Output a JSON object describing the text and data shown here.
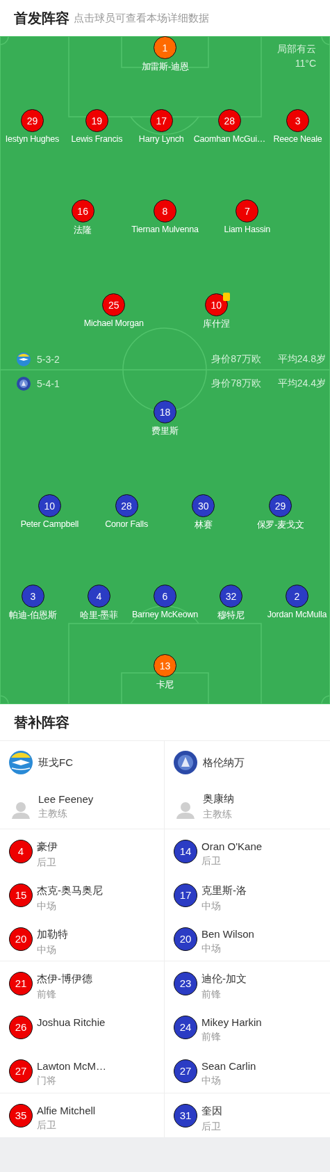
{
  "header": {
    "title": "首发阵容",
    "hint": "点击球员可查看本场详细数据"
  },
  "weather": {
    "condition": "局部有云",
    "temperature": "11°C"
  },
  "teams": [
    {
      "color": "#ee0000",
      "formation": "5-3-2",
      "value": "身价87万欧",
      "avg_age": "平均24.8岁",
      "lines": [
        [
          {
            "number": "1",
            "name": "加雷斯-迪恩",
            "kind": "goalkeeper",
            "yellow_card": false
          }
        ],
        [
          {
            "number": "29",
            "name": "Iestyn Hughes",
            "kind": "outfield",
            "yellow_card": false
          },
          {
            "number": "19",
            "name": "Lewis Francis",
            "kind": "outfield",
            "yellow_card": false
          },
          {
            "number": "17",
            "name": "Harry Lynch",
            "kind": "outfield",
            "yellow_card": false
          },
          {
            "number": "28",
            "name": "Caomhan McGui…",
            "kind": "outfield",
            "yellow_card": false
          },
          {
            "number": "3",
            "name": "Reece Neale",
            "kind": "outfield",
            "yellow_card": false
          }
        ],
        [
          {
            "number": "16",
            "name": "法隆",
            "kind": "outfield",
            "yellow_card": false
          },
          {
            "number": "8",
            "name": "Tiernan Mulvenna",
            "kind": "outfield",
            "yellow_card": false
          },
          {
            "number": "7",
            "name": "Liam Hassin",
            "kind": "outfield",
            "yellow_card": false
          }
        ],
        [
          {
            "number": "25",
            "name": "Michael Morgan",
            "kind": "outfield",
            "yellow_card": false
          },
          {
            "number": "10",
            "name": "库什涅",
            "kind": "outfield",
            "yellow_card": true
          }
        ]
      ]
    },
    {
      "color": "#2b3cc4",
      "formation": "5-4-1",
      "value": "身价78万欧",
      "avg_age": "平均24.4岁",
      "lines": [
        [
          {
            "number": "18",
            "name": "费里斯",
            "kind": "outfield",
            "yellow_card": false
          }
        ],
        [
          {
            "number": "10",
            "name": "Peter Campbell",
            "kind": "outfield",
            "yellow_card": false
          },
          {
            "number": "28",
            "name": "Conor Falls",
            "kind": "outfield",
            "yellow_card": false
          },
          {
            "number": "30",
            "name": "林赛",
            "kind": "outfield",
            "yellow_card": false
          },
          {
            "number": "29",
            "name": "保罗-麦戈文",
            "kind": "outfield",
            "yellow_card": false
          }
        ],
        [
          {
            "number": "3",
            "name": "帕迪-伯恩斯",
            "kind": "outfield",
            "yellow_card": false
          },
          {
            "number": "4",
            "name": "哈里-墨菲",
            "kind": "outfield",
            "yellow_card": false
          },
          {
            "number": "6",
            "name": "Barney McKeown",
            "kind": "outfield",
            "yellow_card": false
          },
          {
            "number": "32",
            "name": "穆特尼",
            "kind": "outfield",
            "yellow_card": false
          },
          {
            "number": "2",
            "name": "Jordan McMulla",
            "kind": "outfield",
            "yellow_card": false
          }
        ],
        [
          {
            "number": "13",
            "name": "卡尼",
            "kind": "goalkeeper",
            "yellow_card": false
          }
        ]
      ]
    }
  ],
  "substitutes": {
    "title": "替补阵容",
    "teams": [
      {
        "color": "#ee0000",
        "name": "班戈FC",
        "coach": {
          "name": "Lee Feeney",
          "role": "主教练"
        },
        "groups": [
          [
            {
              "number": "4",
              "name": "豪伊",
              "position": "后卫"
            },
            {
              "number": "15",
              "name": "杰克-奥马奥尼",
              "position": "中场"
            },
            {
              "number": "20",
              "name": "加勒特",
              "position": "中场"
            }
          ],
          [
            {
              "number": "21",
              "name": "杰伊-博伊德",
              "position": "前锋"
            },
            {
              "number": "26",
              "name": "Joshua Ritchie"
            },
            {
              "number": "27",
              "name": "Lawton McM…",
              "position": "门将"
            }
          ],
          [
            {
              "number": "35",
              "name": "Alfie Mitchell",
              "position": "后卫"
            }
          ]
        ]
      },
      {
        "color": "#2b3cc4",
        "name": "格伦纳万",
        "coach": {
          "name": "奥康纳",
          "role": "主教练"
        },
        "groups": [
          [
            {
              "number": "14",
              "name": "Oran O'Kane",
              "position": "后卫"
            },
            {
              "number": "17",
              "name": "克里斯-洛",
              "position": "中场"
            },
            {
              "number": "20",
              "name": "Ben Wilson",
              "position": "中场"
            }
          ],
          [
            {
              "number": "23",
              "name": "迪伦-加文",
              "position": "前锋"
            },
            {
              "number": "24",
              "name": "Mikey Harkin",
              "position": "前锋"
            },
            {
              "number": "27",
              "name": "Sean Carlin",
              "position": "中场"
            }
          ],
          [
            {
              "number": "31",
              "name": "奎因",
              "position": "后卫"
            }
          ]
        ]
      }
    ]
  }
}
